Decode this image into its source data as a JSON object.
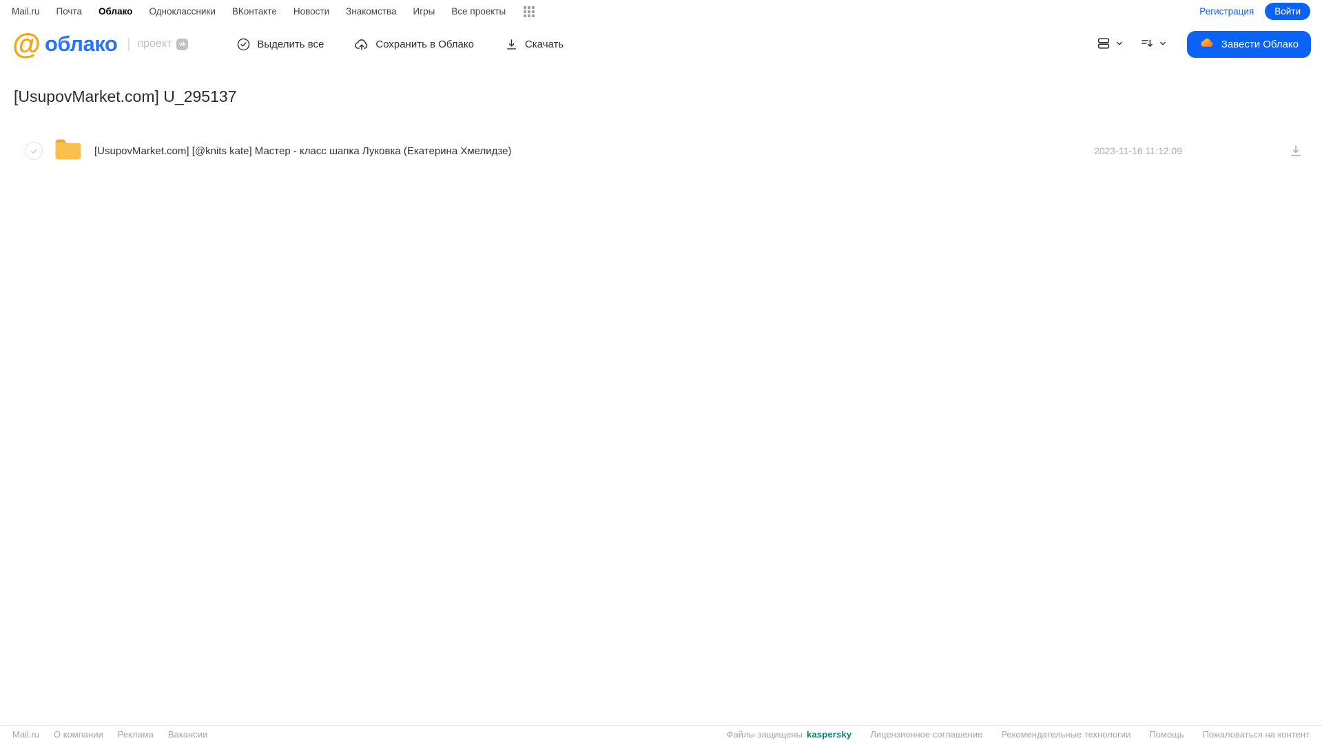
{
  "top_nav": {
    "links": [
      "Mail.ru",
      "Почта",
      "Облако",
      "Одноклассники",
      "ВКонтакте",
      "Новости",
      "Знакомства",
      "Игры",
      "Все проекты"
    ],
    "active_link": "Облако",
    "register_label": "Регистрация",
    "login_label": "Войти"
  },
  "header": {
    "logo_at": "@",
    "logo_text": "облако",
    "project_label": "проект",
    "vk_badge": "vk",
    "toolbar": {
      "select_all_label": "Выделить все",
      "save_to_cloud_label": "Сохранить в Облако",
      "download_label": "Скачать"
    },
    "create_cloud_label": "Завести Облако"
  },
  "main": {
    "title": "[UsupovMarket.com] U_295137",
    "files": [
      {
        "name": "[UsupovMarket.com] [@knits kate] Мастер - класс шапка Луковка (Екатерина Хмелидзе)",
        "date": "2023-11-16 11:12:09"
      }
    ]
  },
  "footer": {
    "left_links": [
      "Mail.ru",
      "О компании",
      "Реклама",
      "Вакансии"
    ],
    "protected_label": "Файлы защищены",
    "kaspersky_label": "kaspersky",
    "right_links": [
      "Лицензионное соглашение",
      "Рекомендательные технологии",
      "Помощь",
      "Пожаловаться на контент"
    ]
  },
  "icons": {
    "grid_icon": "3x3-dots-apps-grid",
    "check_circle_icon": "circle-with-checkmark",
    "cloud_upload_icon": "cloud-with-up-arrow",
    "download_icon": "down-arrow-with-bar",
    "view_toggle_icon": "two-stacked-rows",
    "sort_icon": "lines-with-down-arrow",
    "chevron_down_icon": "chevron-down",
    "folder_icon": "yellow-folder",
    "cloud_icon": "orange-cloud"
  },
  "colors": {
    "accent_blue": "#0b63f6",
    "logo_orange": "#ffa200",
    "logo_blue": "#2775fc",
    "folder_yellow": "#f9c04c",
    "kaspersky_teal": "#00846e",
    "muted_gray": "#a9acb0"
  }
}
